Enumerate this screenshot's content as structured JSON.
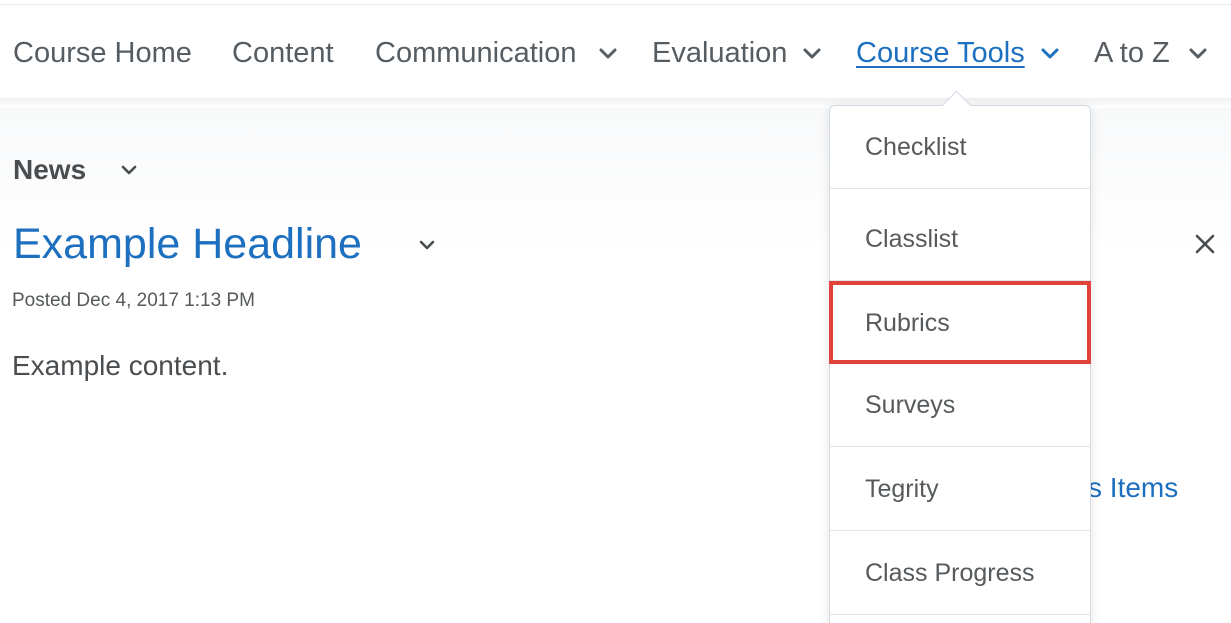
{
  "nav": {
    "items": [
      {
        "label": "Course Home",
        "dropdown": false
      },
      {
        "label": "Content",
        "dropdown": false
      },
      {
        "label": "Communication",
        "dropdown": true
      },
      {
        "label": "Evaluation",
        "dropdown": true
      },
      {
        "label": "Course Tools",
        "dropdown": true,
        "active": true
      },
      {
        "label": "A to Z",
        "dropdown": true
      }
    ]
  },
  "widget": {
    "title": "News",
    "headline": "Example Headline",
    "posted": "Posted Dec 4, 2017 1:13 PM",
    "content": "Example content.",
    "news_items_link": "News Items"
  },
  "dropdown": {
    "items": [
      {
        "label": "Checklist"
      },
      {
        "label": "Classlist"
      },
      {
        "label": "Rubrics",
        "highlighted": true
      },
      {
        "label": "Surveys"
      },
      {
        "label": "Tegrity"
      },
      {
        "label": "Class Progress"
      }
    ]
  },
  "colors": {
    "link_blue": "#1d6fbf",
    "highlight_red": "#e0413b",
    "text_gray": "#555c62"
  },
  "icons": {
    "chevron": "chevron-down-icon",
    "close": "close-icon"
  }
}
